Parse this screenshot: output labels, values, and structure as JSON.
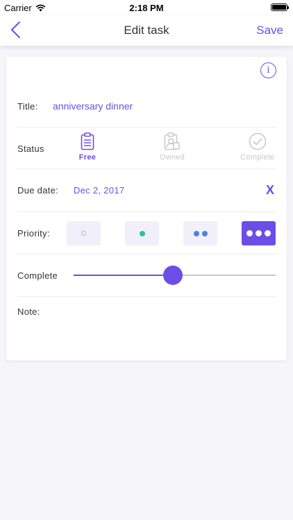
{
  "status_bar": {
    "carrier": "Carrier",
    "time": "2:18 PM",
    "icons": [
      "wifi-icon",
      "battery-icon"
    ]
  },
  "nav": {
    "title": "Edit task",
    "save_label": "Save",
    "back_icon": "chevron-left-icon"
  },
  "form": {
    "info_icon": "info-icon",
    "info_glyph": "i",
    "title_label": "Title:",
    "title_value": "anniversary dinner",
    "status_label": "Status",
    "status_options": [
      {
        "label": "Free",
        "icon": "clipboard-icon",
        "selected": true
      },
      {
        "label": "Owned",
        "icon": "user-clipboard-icon",
        "selected": false
      },
      {
        "label": "Complete",
        "icon": "checkmark-circle-icon",
        "selected": false
      }
    ],
    "due_label": "Due date:",
    "due_value": "Dec 2, 2017",
    "clear_label": "X",
    "priority_label": "Priority:",
    "priority_levels": 4,
    "priority_selected": 4,
    "complete_label": "Complete",
    "complete_value": 0.49,
    "note_label": "Note:"
  },
  "colors": {
    "accent": "#6b4ee6",
    "green": "#2cc39b",
    "blue": "#4b82e0",
    "muted": "#c8c8cc",
    "background": "#f5f5fa"
  }
}
